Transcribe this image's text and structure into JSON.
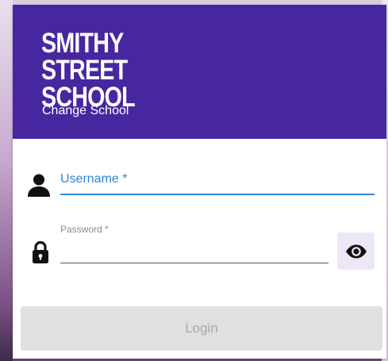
{
  "header": {
    "school_name_line1": "SMITHY STREET",
    "school_name_line2": "SCHOOL",
    "change_school_label": "Change School",
    "background_color": "#4727a0"
  },
  "form": {
    "username": {
      "label": "Username *",
      "value": "",
      "icon": "person-icon",
      "accent_color": "#2f86d6"
    },
    "password": {
      "label": "Password *",
      "value": "",
      "icon": "lock-icon",
      "toggle_icon": "eye-icon"
    },
    "login_button_label": "Login"
  }
}
